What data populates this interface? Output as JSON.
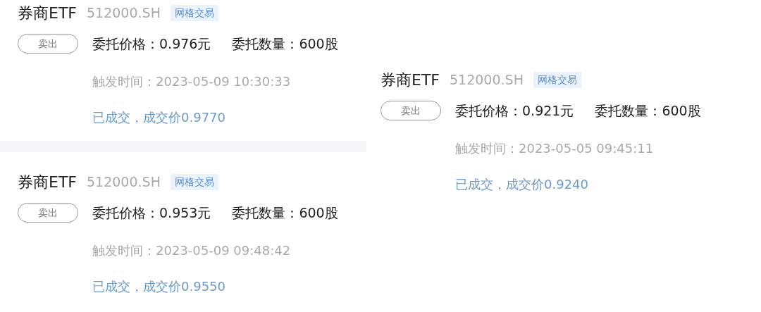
{
  "columns": [
    {
      "orders": [
        {
          "name": "券商ETF",
          "code": "512000.SH",
          "tag": "网格交易",
          "action": "卖出",
          "price": "委托价格：0.976元",
          "quantity": "委托数量：600股",
          "trigger_time": "触发时间：2023-05-09 10:30:33",
          "status": "已成交，成交价0.9770"
        },
        {
          "name": "券商ETF",
          "code": "512000.SH",
          "tag": "网格交易",
          "action": "卖出",
          "price": "委托价格：0.953元",
          "quantity": "委托数量：600股",
          "trigger_time": "触发时间：2023-05-09 09:48:42",
          "status": "已成交，成交价0.9550"
        }
      ]
    },
    {
      "orders": [
        {
          "name": "券商ETF",
          "code": "512000.SH",
          "tag": "网格交易",
          "action": "卖出",
          "price": "委托价格：0.921元",
          "quantity": "委托数量：600股",
          "trigger_time": "触发时间：2023-05-05 09:45:11",
          "status": "已成交，成交价0.9240"
        }
      ]
    }
  ]
}
